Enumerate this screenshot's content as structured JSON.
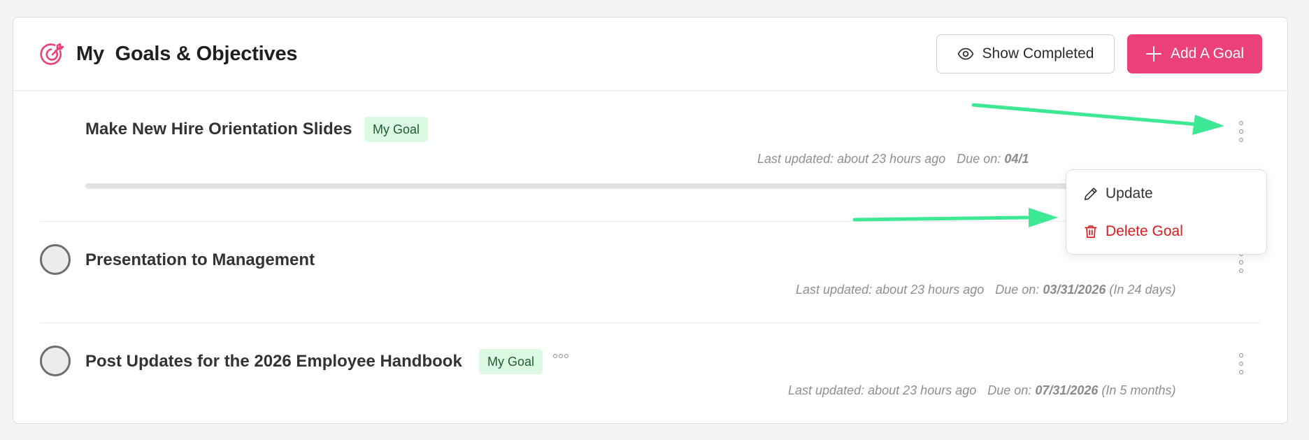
{
  "header": {
    "icon": "target-icon",
    "title": "My  Goals & Objectives",
    "show_completed_label": "Show Completed",
    "show_completed_icon": "eye-icon",
    "add_goal_label": "Add A Goal",
    "add_goal_icon": "plus-icon"
  },
  "colors": {
    "accent": "#ec407a",
    "tag_bg": "#dcf9e4",
    "tag_text": "#1d5e2e",
    "delete": "#dc1c1c",
    "annotation_arrow": "#3de894"
  },
  "goals": [
    {
      "title": "Make New Hire Orientation Slides",
      "tag": "My Goal",
      "last_updated_label": "Last updated:",
      "last_updated": "about 23 hours ago",
      "due_label": "Due on:",
      "due_date": "04/1"
    },
    {
      "title": "Presentation to Management",
      "last_updated_label": "Last updated:",
      "last_updated": "about 23 hours ago",
      "due_label": "Due on:",
      "due_date": "03/31/2026",
      "due_relative": "(In 24 days)"
    },
    {
      "title": "Post Updates for the 2026 Employee Handbook",
      "tag": "My Goal",
      "more_indicator": "ooo",
      "last_updated_label": "Last updated:",
      "last_updated": "about 23 hours ago",
      "due_label": "Due on:",
      "due_date": "07/31/2026",
      "due_relative": "(In 5 months)"
    }
  ],
  "dropdown": {
    "update_label": "Update",
    "update_icon": "pencil-icon",
    "delete_label": "Delete Goal",
    "delete_icon": "trash-icon"
  }
}
